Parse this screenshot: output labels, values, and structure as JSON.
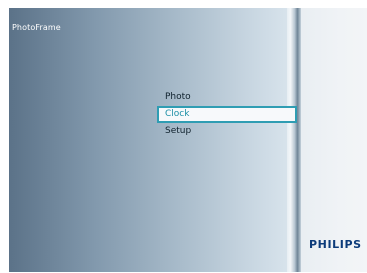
{
  "header": {
    "app_title": "PhotoFrame"
  },
  "menu": {
    "items": [
      {
        "label": "Photo",
        "selected": false
      },
      {
        "label": "Clock",
        "selected": true
      },
      {
        "label": "Setup",
        "selected": false
      }
    ]
  },
  "brand": {
    "logo_text": "PHILIPS"
  },
  "colors": {
    "selection_border": "#2f9db3",
    "selection_text": "#1c8fa6",
    "brand_blue": "#0c3b7a"
  }
}
